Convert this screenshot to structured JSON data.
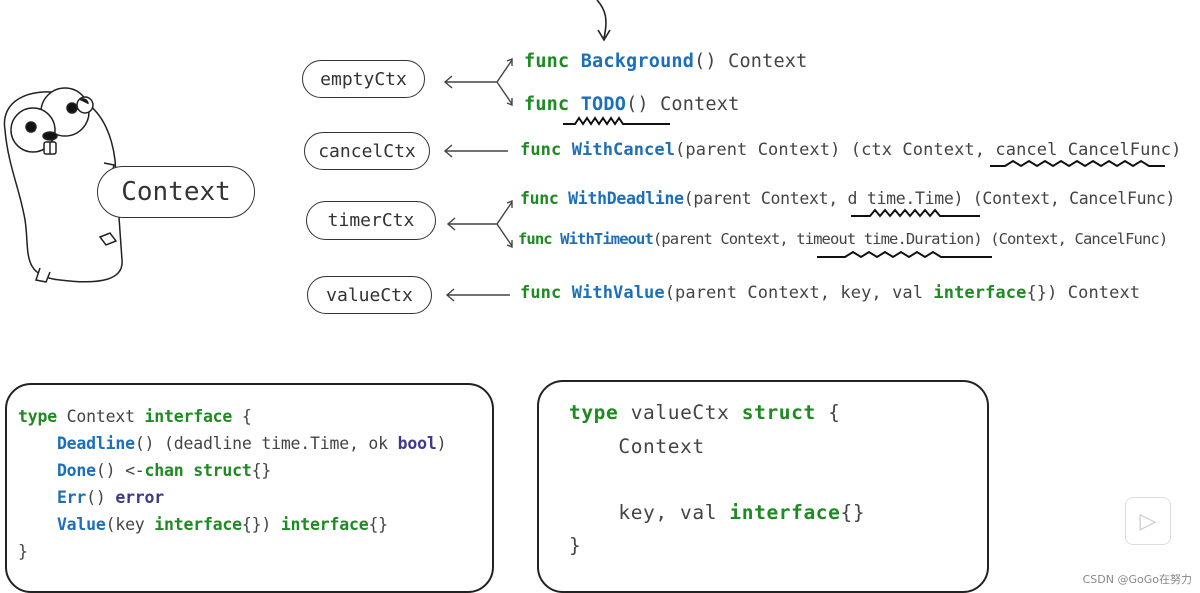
{
  "gopher": {
    "label": "Context"
  },
  "types": [
    {
      "id": "empty",
      "label": "emptyCtx"
    },
    {
      "id": "cancel",
      "label": "cancelCtx"
    },
    {
      "id": "timer",
      "label": "timerCtx"
    },
    {
      "id": "value",
      "label": "valueCtx"
    }
  ],
  "funcs": [
    [
      {
        "t": "func ",
        "c": "kw"
      },
      {
        "t": "Background",
        "c": "fn"
      },
      {
        "t": "() Context",
        "c": "tx"
      }
    ],
    [
      {
        "t": "func ",
        "c": "kw"
      },
      {
        "t": "TODO",
        "c": "fn"
      },
      {
        "t": "() Context",
        "c": "tx"
      }
    ],
    [
      {
        "t": "func ",
        "c": "kw"
      },
      {
        "t": "WithCancel",
        "c": "fn"
      },
      {
        "t": "(parent Context) (ctx Context, cancel CancelFunc)",
        "c": "tx"
      }
    ],
    [
      {
        "t": "func ",
        "c": "kw"
      },
      {
        "t": "WithDeadline",
        "c": "fn"
      },
      {
        "t": "(parent Context, d time.Time) (Context, CancelFunc)",
        "c": "tx"
      }
    ],
    [
      {
        "t": "func ",
        "c": "kw"
      },
      {
        "t": "WithTimeout",
        "c": "fn"
      },
      {
        "t": "(parent Context, timeout time.Duration) (Context, CancelFunc)",
        "c": "tx"
      }
    ],
    [
      {
        "t": "func ",
        "c": "kw"
      },
      {
        "t": "WithValue",
        "c": "fn"
      },
      {
        "t": "(parent Context, key, val ",
        "c": "tx"
      },
      {
        "t": "interface",
        "c": "kw"
      },
      {
        "t": "{}) Context",
        "c": "tx"
      }
    ]
  ],
  "interface_code": [
    [
      {
        "t": "type",
        "c": "kw"
      },
      {
        "t": " Context ",
        "c": "tx"
      },
      {
        "t": "interface",
        "c": "kw"
      },
      {
        "t": " {",
        "c": "tx"
      }
    ],
    [
      {
        "t": "    ",
        "c": "tx"
      },
      {
        "t": "Deadline",
        "c": "fn"
      },
      {
        "t": "() (deadline time.Time, ok ",
        "c": "tx"
      },
      {
        "t": "bool",
        "c": "nv"
      },
      {
        "t": ")",
        "c": "tx"
      }
    ],
    [
      {
        "t": "    ",
        "c": "tx"
      },
      {
        "t": "Done",
        "c": "fn"
      },
      {
        "t": "() <-",
        "c": "tx"
      },
      {
        "t": "chan struct",
        "c": "kw"
      },
      {
        "t": "{}",
        "c": "tx"
      }
    ],
    [
      {
        "t": "    ",
        "c": "tx"
      },
      {
        "t": "Err",
        "c": "fn"
      },
      {
        "t": "() ",
        "c": "tx"
      },
      {
        "t": "error",
        "c": "nv"
      }
    ],
    [
      {
        "t": "    ",
        "c": "tx"
      },
      {
        "t": "Value",
        "c": "fn"
      },
      {
        "t": "(key ",
        "c": "tx"
      },
      {
        "t": "interface",
        "c": "kw"
      },
      {
        "t": "{}) ",
        "c": "tx"
      },
      {
        "t": "interface",
        "c": "kw"
      },
      {
        "t": "{}",
        "c": "tx"
      }
    ],
    [
      {
        "t": "}",
        "c": "tx"
      }
    ]
  ],
  "struct_code": [
    [
      {
        "t": "type",
        "c": "kw"
      },
      {
        "t": " valueCtx ",
        "c": "tx"
      },
      {
        "t": "struct",
        "c": "kw"
      },
      {
        "t": " {",
        "c": "tx"
      }
    ],
    [
      {
        "t": "    Context",
        "c": "tx"
      }
    ],
    [
      {
        "t": "    key, val ",
        "c": "tx"
      },
      {
        "t": "interface",
        "c": "kw"
      },
      {
        "t": "{}",
        "c": "tx"
      }
    ],
    [
      {
        "t": "}",
        "c": "tx"
      }
    ]
  ],
  "watermark": "CSDN @GoGo在努力",
  "play_icon": "play-icon",
  "colors": {
    "keyword": "#1f8a22",
    "function": "#1c6fb8",
    "builtin": "#3d3a8c"
  }
}
